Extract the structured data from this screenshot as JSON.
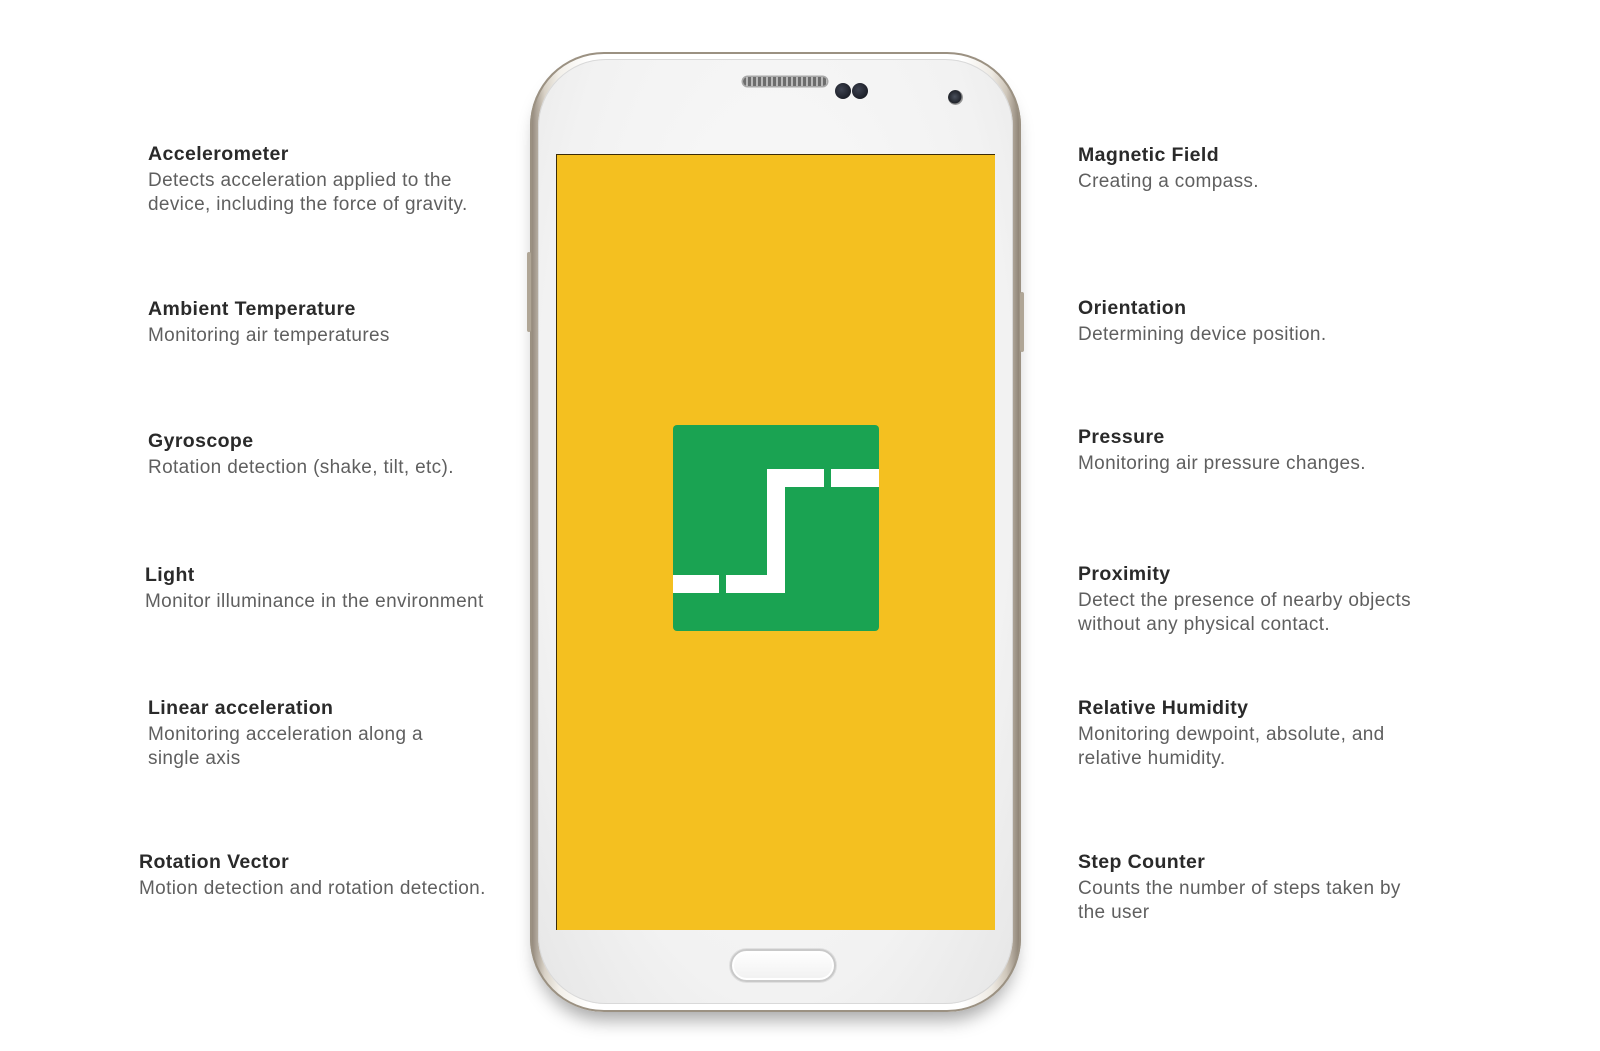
{
  "left_features": [
    {
      "title": "Accelerometer",
      "desc": "Detects acceleration applied to the device, including the force of gravity."
    },
    {
      "title": "Ambient Temperature",
      "desc": "Monitoring air temperatures"
    },
    {
      "title": "Gyroscope",
      "desc": "Rotation detection (shake, tilt, etc)."
    },
    {
      "title": "Light",
      "desc": "Monitor illuminance in the environment"
    },
    {
      "title": "Linear acceleration",
      "desc": "Monitoring acceleration along a single axis"
    },
    {
      "title": "Rotation Vector",
      "desc": "Motion detection and rotation detection."
    }
  ],
  "right_features": [
    {
      "title": "Magnetic Field",
      "desc": "Creating a compass."
    },
    {
      "title": "Orientation",
      "desc": "Determining device position."
    },
    {
      "title": "Pressure",
      "desc": "Monitoring air pressure changes."
    },
    {
      "title": "Proximity",
      "desc": "Detect the presence of nearby objects without any physical contact."
    },
    {
      "title": "Relative Humidity",
      "desc": "Monitoring dewpoint, absolute, and relative humidity."
    },
    {
      "title": "Step Counter",
      "desc": "Counts the number of steps taken by the user"
    }
  ],
  "colors": {
    "screen_background": "#f4c020",
    "logo_background": "#1aa352",
    "logo_lines": "#ffffff",
    "title_text": "#2a2a2a",
    "description_text": "#5f5f5f"
  },
  "icons": {
    "app_logo": "step-signal-logo-icon"
  }
}
